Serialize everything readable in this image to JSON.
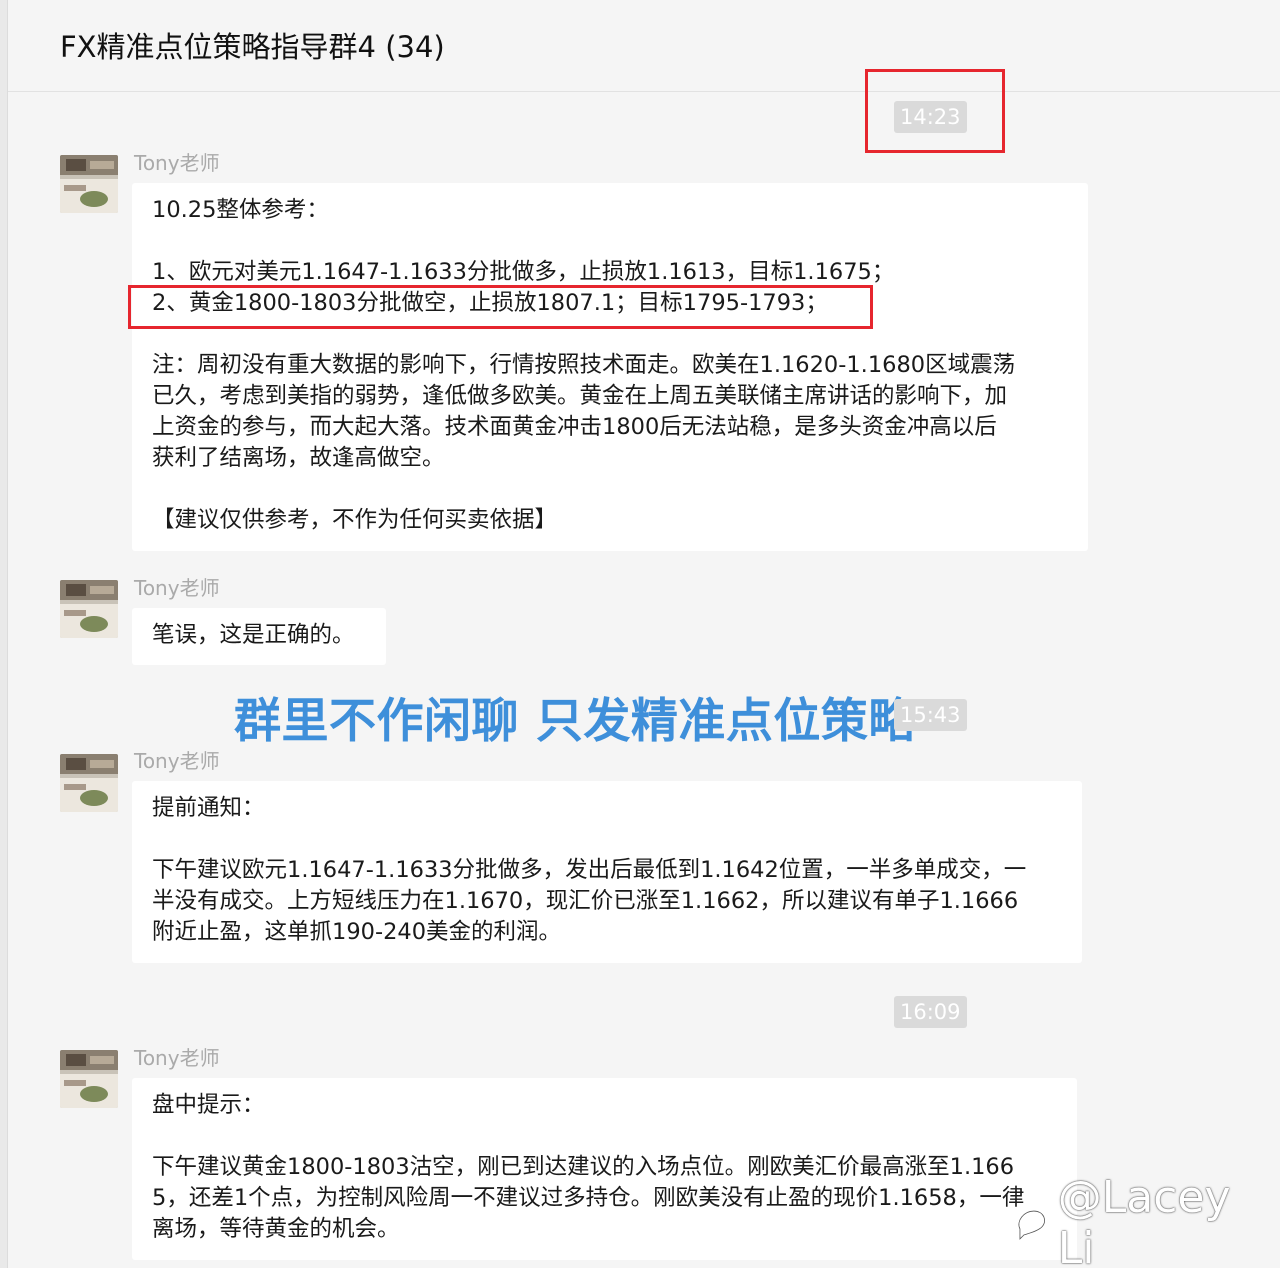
{
  "header": {
    "title": "FX精准点位策略指导群4 (34)"
  },
  "timestamps": {
    "t1": "14:23",
    "t2": "15:43",
    "t3": "16:09"
  },
  "banner": {
    "text": "群里不作闲聊 只发精准点位策略"
  },
  "watermark": {
    "text": "@Lacey Li",
    "icon": "weibo-icon"
  },
  "messages": [
    {
      "sender": "Tony老师",
      "lines": [
        "10.25整体参考：",
        "",
        "1、欧元对美元1.1647-1.1633分批做多，止损放1.1613，目标1.1675；",
        "2、黄金1800-1803分批做空，止损放1807.1；目标1795-1793；",
        "",
        "注：周初没有重大数据的影响下，行情按照技术面走。欧美在1.1620-1.1680区域震荡",
        "已久，考虑到美指的弱势，逢低做多欧美。黄金在上周五美联储主席讲话的影响下，加",
        "上资金的参与，而大起大落。技术面黄金冲击1800后无法站稳，是多头资金冲高以后",
        "获利了结离场，故逢高做空。",
        "",
        "【建议仅供参考，不作为任何买卖依据】"
      ]
    },
    {
      "sender": "Tony老师",
      "lines": [
        "笔误，这是正确的。"
      ]
    },
    {
      "sender": "Tony老师",
      "lines": [
        "提前通知：",
        "",
        "下午建议欧元1.1647-1.1633分批做多，发出后最低到1.1642位置，一半多单成交，一",
        "半没有成交。上方短线压力在1.1670，现汇价已涨至1.1662，所以建议有单子1.1666",
        "附近止盈，这单抓190-240美金的利润。"
      ]
    },
    {
      "sender": "Tony老师",
      "lines": [
        "盘中提示：",
        "",
        "下午建议黄金1800-1803沽空，刚已到达建议的入场点位。刚欧美汇价最高涨至1.166",
        "5，还差1个点，为控制风险周一不建议过多持仓。刚欧美没有止盈的现价1.1658，一律",
        "离场，等待黄金的机会。"
      ]
    }
  ]
}
